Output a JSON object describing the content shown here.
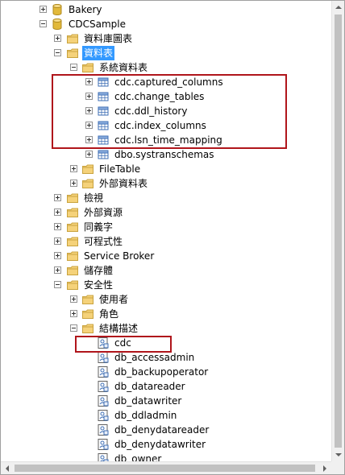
{
  "tree": {
    "nodes": [
      {
        "label": "Bakery",
        "icon": "database-icon",
        "expander": "plus"
      },
      {
        "label": "CDCSample",
        "icon": "database-icon",
        "expander": "minus"
      },
      {
        "label": "資料庫圖表",
        "icon": "folder-icon",
        "expander": "plus"
      },
      {
        "label": "資料表",
        "icon": "folder-icon",
        "expander": "minus",
        "selected": true
      },
      {
        "label": "系統資料表",
        "icon": "folder-icon",
        "expander": "minus"
      },
      {
        "label": "cdc.captured_columns",
        "icon": "table-icon",
        "expander": "plus"
      },
      {
        "label": "cdc.change_tables",
        "icon": "table-icon",
        "expander": "plus"
      },
      {
        "label": "cdc.ddl_history",
        "icon": "table-icon",
        "expander": "plus"
      },
      {
        "label": "cdc.index_columns",
        "icon": "table-icon",
        "expander": "plus"
      },
      {
        "label": "cdc.lsn_time_mapping",
        "icon": "table-icon",
        "expander": "plus"
      },
      {
        "label": "dbo.systranschemas",
        "icon": "table-icon",
        "expander": "plus"
      },
      {
        "label": "FileTable",
        "icon": "folder-icon",
        "expander": "plus"
      },
      {
        "label": "外部資料表",
        "icon": "folder-icon",
        "expander": "plus"
      },
      {
        "label": "檢視",
        "icon": "folder-icon",
        "expander": "plus"
      },
      {
        "label": "外部資源",
        "icon": "folder-icon",
        "expander": "plus"
      },
      {
        "label": "同義字",
        "icon": "folder-icon",
        "expander": "plus"
      },
      {
        "label": "可程式性",
        "icon": "folder-icon",
        "expander": "plus"
      },
      {
        "label": "Service Broker",
        "icon": "folder-icon",
        "expander": "plus"
      },
      {
        "label": "儲存體",
        "icon": "folder-icon",
        "expander": "plus"
      },
      {
        "label": "安全性",
        "icon": "folder-icon",
        "expander": "minus"
      },
      {
        "label": "使用者",
        "icon": "folder-icon",
        "expander": "plus"
      },
      {
        "label": "角色",
        "icon": "folder-icon",
        "expander": "plus"
      },
      {
        "label": "結構描述",
        "icon": "folder-icon",
        "expander": "minus"
      },
      {
        "label": "cdc",
        "icon": "schema-icon",
        "expander": "none"
      },
      {
        "label": "db_accessadmin",
        "icon": "schema-icon",
        "expander": "none"
      },
      {
        "label": "db_backupoperator",
        "icon": "schema-icon",
        "expander": "none"
      },
      {
        "label": "db_datareader",
        "icon": "schema-icon",
        "expander": "none"
      },
      {
        "label": "db_datawriter",
        "icon": "schema-icon",
        "expander": "none"
      },
      {
        "label": "db_ddladmin",
        "icon": "schema-icon",
        "expander": "none"
      },
      {
        "label": "db_denydatareader",
        "icon": "schema-icon",
        "expander": "none"
      },
      {
        "label": "db_denydatawriter",
        "icon": "schema-icon",
        "expander": "none"
      },
      {
        "label": "db_owner",
        "icon": "schema-icon",
        "expander": "none"
      }
    ]
  },
  "colors": {
    "selection": "#3399ff",
    "highlight_box": "#b0151b",
    "folder": "#f5d27a",
    "database": "#e2b93b"
  }
}
